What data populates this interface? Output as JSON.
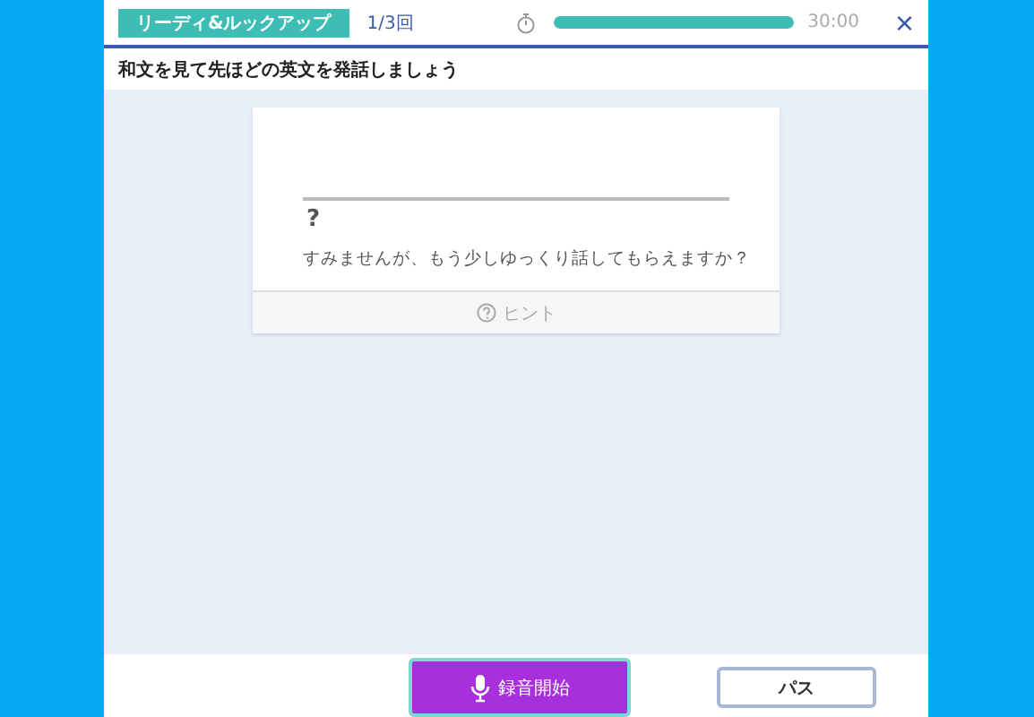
{
  "header": {
    "category": "リーディ&ルックアップ",
    "counter": "1/3回",
    "timer": {
      "level": 1.0,
      "reading": "30:00"
    },
    "close": "×"
  },
  "instruction": "和文を見て先ほどの英文を発話しましょう",
  "card": {
    "answer": "?",
    "prompt": "すみませんが、もう少しゆっくり話してもらえますか？",
    "hint": "ヒント"
  },
  "footer": {
    "record_button": "録音開始",
    "pass_button": "パス"
  }
}
